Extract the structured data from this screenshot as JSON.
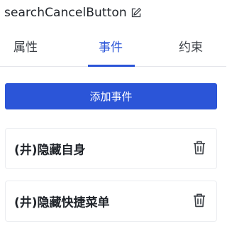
{
  "header": {
    "component_name": "searchCancelButton"
  },
  "tabs": [
    {
      "label": "属性",
      "active": false
    },
    {
      "label": "事件",
      "active": true
    },
    {
      "label": "约束",
      "active": false
    }
  ],
  "actions": {
    "add_event_label": "添加事件"
  },
  "events": [
    {
      "label": "(井)隐藏自身"
    },
    {
      "label": "(井)隐藏快捷菜单"
    }
  ],
  "colors": {
    "accent": "#2b55d8",
    "text": "#1f2329",
    "border": "#ebedf0"
  },
  "icons": {
    "edit": "edit-icon",
    "delete": "trash-icon"
  }
}
